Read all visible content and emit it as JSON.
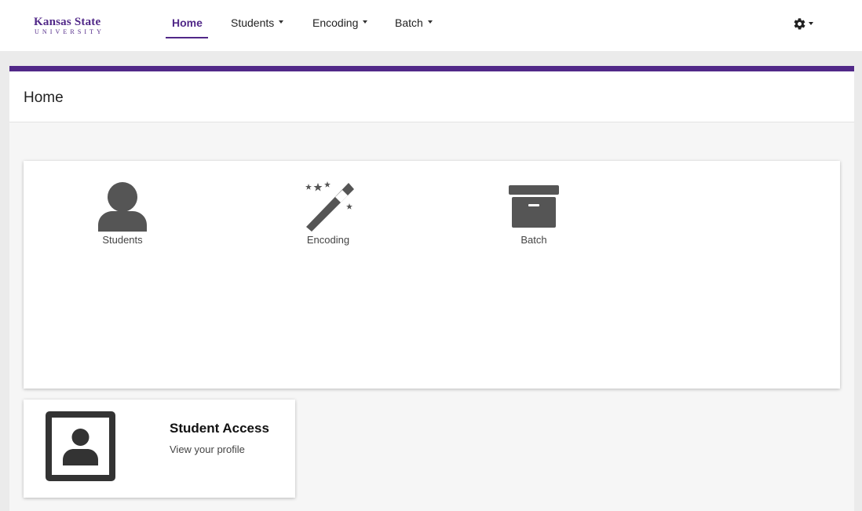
{
  "brand": {
    "line1": "Kansas State",
    "line2": "UNIVERSITY",
    "color": "#512888"
  },
  "nav": {
    "items": [
      {
        "label": "Home",
        "active": true
      },
      {
        "label": "Students",
        "dropdown": true
      },
      {
        "label": "Encoding",
        "dropdown": true
      },
      {
        "label": "Batch",
        "dropdown": true
      }
    ],
    "settings_icon": "gear-icon"
  },
  "page": {
    "title": "Home"
  },
  "tiles": [
    {
      "label": "Students",
      "icon": "user-icon"
    },
    {
      "label": "Encoding",
      "icon": "magic-wand-icon"
    },
    {
      "label": "Batch",
      "icon": "archive-box-icon"
    }
  ],
  "student_access": {
    "title": "Student Access",
    "subtitle": "View your profile",
    "icon": "profile-portrait-icon"
  },
  "colors": {
    "accent": "#512888",
    "icon": "#555555",
    "background": "#ebebeb",
    "panel": "#f6f6f6"
  }
}
